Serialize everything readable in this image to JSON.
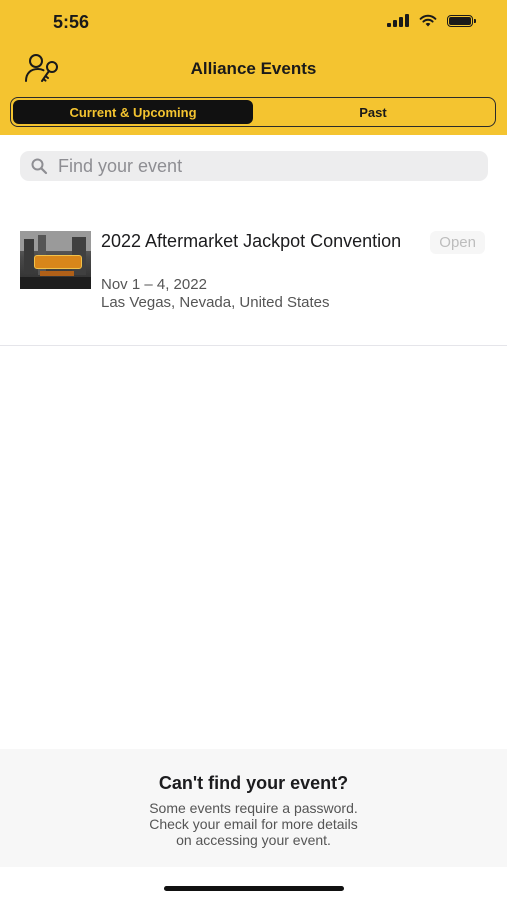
{
  "status_bar": {
    "time": "5:56",
    "icons": [
      "signal-icon",
      "wifi-icon",
      "battery-icon"
    ]
  },
  "header": {
    "title": "Alliance Events",
    "login_icon": "user-key-icon",
    "background_color": "#f4c430"
  },
  "segments": {
    "current_label": "Current & Upcoming",
    "past_label": "Past",
    "selected": "Current & Upcoming"
  },
  "search": {
    "placeholder": "Find your event",
    "value": "",
    "icon": "search-icon"
  },
  "events": [
    {
      "title": "2022 Aftermarket Jackpot Convention",
      "date": "Nov 1 – 4, 2022",
      "location": "Las Vegas, Nevada, United States",
      "status": "Open",
      "thumbnail": "event-thumbnail-image"
    }
  ],
  "footer": {
    "title": "Can't find your event?",
    "line1": "Some events require a password.",
    "line2": "Check your email for more details",
    "line3": "on accessing your event."
  }
}
